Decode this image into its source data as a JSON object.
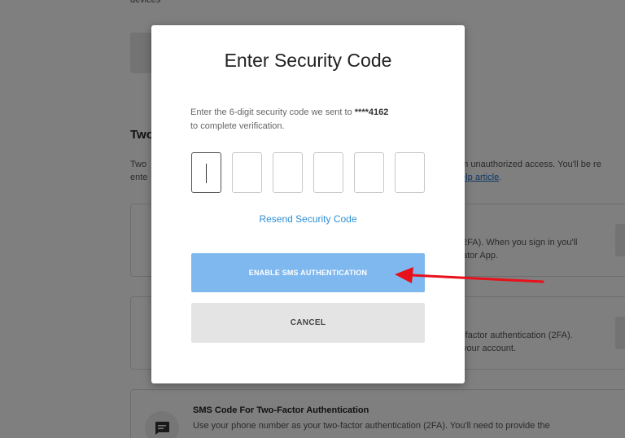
{
  "background": {
    "top_text": "devices",
    "section_heading": "Two",
    "desc_left_line1": "Two",
    "desc_left_line2": "ente",
    "desc_right_line1": "om unauthorized access. You'll be re",
    "desc_right_line2": "help article",
    "desc_right_line2_suffix": ".",
    "card1_line1": "2FA). When you sign in you'll",
    "card1_line2": "ator App.",
    "card2_line1": "-factor authentication (2FA).",
    "card2_line2": "your account.",
    "sms_title": "SMS Code For Two-Factor Authentication",
    "sms_desc": "Use your phone number as your two-factor authentication (2FA). You'll need to provide the",
    "sms_icon": "message-icon"
  },
  "modal": {
    "title": "Enter Security Code",
    "instruction_prefix": "Enter the 6-digit security code we sent to ",
    "phone_masked": "****4162",
    "instruction_suffix": "to complete verification.",
    "code_digits": [
      "",
      "",
      "",
      "",
      "",
      ""
    ],
    "resend_label": "Resend Security Code",
    "enable_label": "ENABLE SMS AUTHENTICATION",
    "cancel_label": "CANCEL"
  },
  "colors": {
    "primary_disabled": "#7fb8ee",
    "link": "#2d8fd6",
    "annotation_arrow": "#e8101a"
  }
}
